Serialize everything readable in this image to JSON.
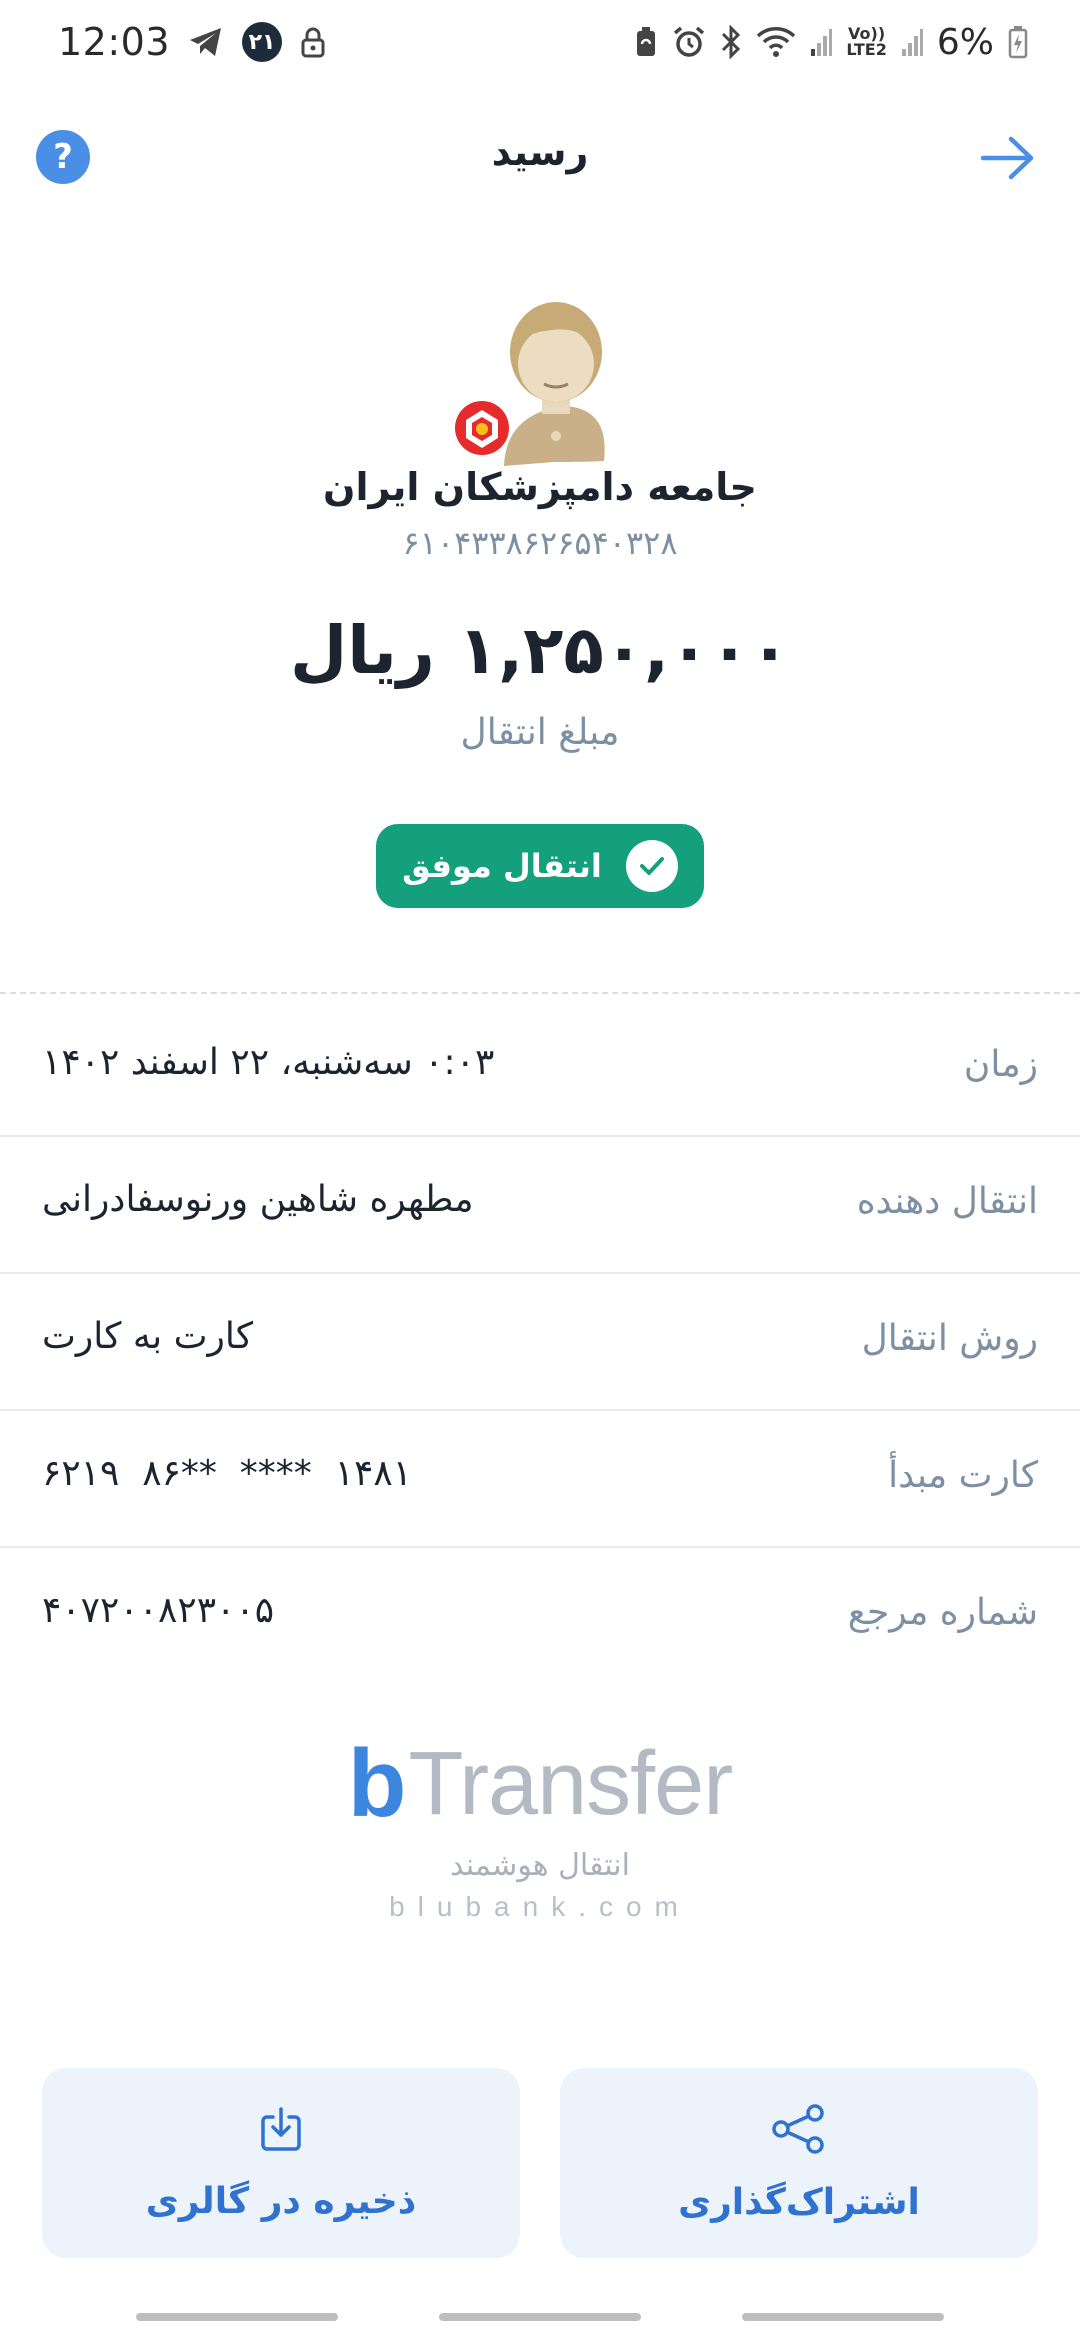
{
  "status_bar": {
    "time": "12:03",
    "notification_badge": "۲۱",
    "network_label_top": "Vo))",
    "network_label_bottom": "LTE2",
    "battery": "6%"
  },
  "header": {
    "title": "رسید",
    "help": "?"
  },
  "recipient": {
    "name": "جامعه دامپزشکان ایران",
    "card_number": "۶۱۰۴۳۳۸۶۲۶۵۴۰۳۲۸"
  },
  "amount": {
    "value": "۱,۲۵۰,۰۰۰ ریال",
    "label": "مبلغ انتقال"
  },
  "status": {
    "label": "انتقال موفق",
    "color": "#14a07c"
  },
  "details": [
    {
      "label": "زمان",
      "value": "۰:۰۳ سه‌شنبه، ۲۲ اسفند ۱۴۰۲"
    },
    {
      "label": "انتقال دهنده",
      "value": "مطهره شاهین ورنوسفادرانی"
    },
    {
      "label": "روش انتقال",
      "value": "کارت به کارت"
    },
    {
      "label": "کارت مبدأ",
      "value": "۶۲۱۹  ۸۶**  ****  ۱۴۸۱"
    },
    {
      "label": "شماره مرجع",
      "value": "۴۰۷۲۰۰۸۲۳۰۰۵"
    }
  ],
  "brand": {
    "b": "b",
    "name": "Transfer",
    "tagline": "انتقال هوشمند",
    "url": "blubank.com"
  },
  "actions": {
    "share_label": "اشتراک‌گذاری",
    "save_label": "ذخیره در گالری"
  },
  "colors": {
    "accent": "#3d86e0",
    "success": "#14a07c",
    "muted_text": "#7d8fa2"
  }
}
